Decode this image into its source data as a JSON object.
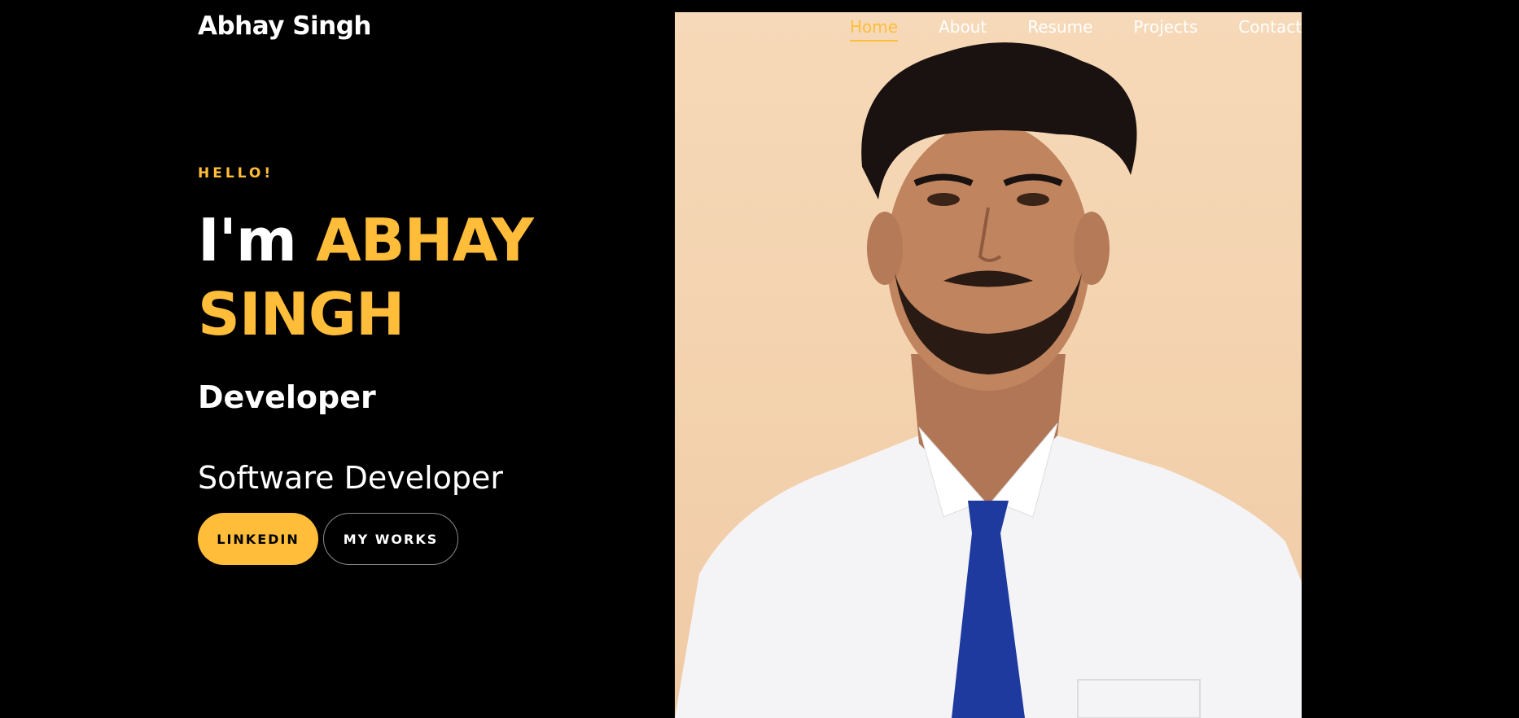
{
  "brand": "Abhay Singh",
  "nav": {
    "items": [
      "Home",
      "About",
      "Resume",
      "Projects",
      "Contact"
    ],
    "active": "Home"
  },
  "hero": {
    "greeting": "HELLO!",
    "intro": "I'm",
    "name": "ABHAY SINGH",
    "role": "Developer",
    "subrole": "Software Developer",
    "buttons": {
      "primary": "LINKEDIN",
      "secondary": "MY WORKS"
    }
  },
  "colors": {
    "accent": "#ffbd39",
    "background": "#000000",
    "text": "#ffffff"
  }
}
